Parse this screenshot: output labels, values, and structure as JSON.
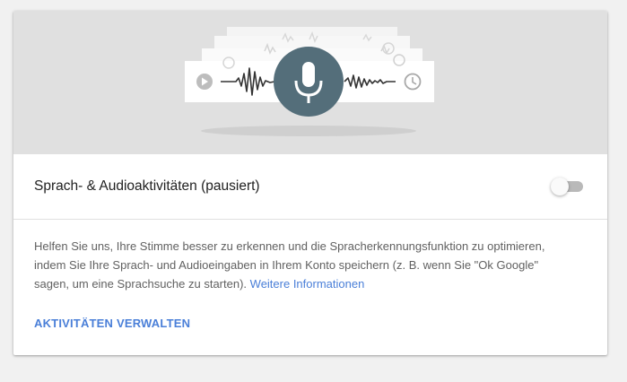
{
  "illustration": {
    "icons": [
      "play-icon",
      "waveform-icon",
      "microphone-icon",
      "clock-icon"
    ],
    "colors": {
      "background": "#e0e0e0",
      "mic_circle": "#546e7a",
      "card": "#ffffff"
    }
  },
  "setting": {
    "title": "Sprach- & Audioaktivitäten (pausiert)",
    "toggle_on": false
  },
  "description": {
    "text": "Helfen Sie uns, Ihre Stimme besser zu erkennen und die Spracherkennungsfunktion zu optimieren, indem Sie Ihre Sprach- und Audioeingaben in Ihrem Konto speichern (z. B. wenn Sie \"Ok Google\" sagen, um eine Sprachsuche zu starten).",
    "link_label": "Weitere Informationen"
  },
  "actions": {
    "manage_label": "AKTIVITÄTEN VERWALTEN"
  },
  "colors": {
    "accent": "#4a7fd8",
    "page_background": "#f1f1f1"
  }
}
